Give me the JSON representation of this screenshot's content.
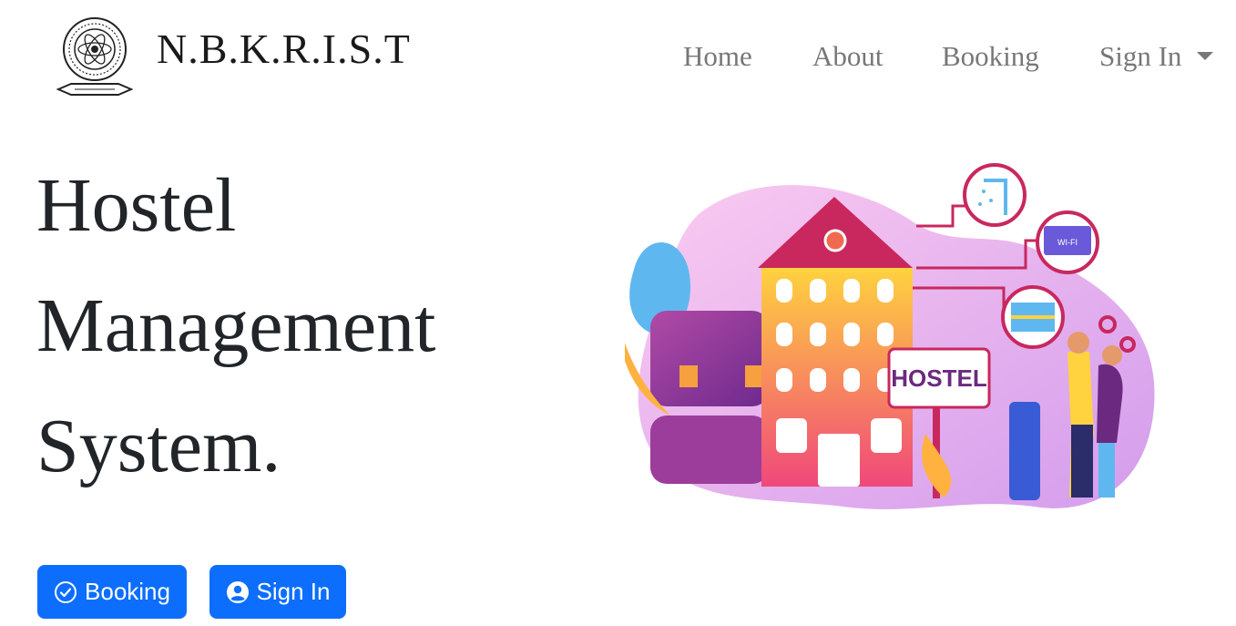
{
  "brand": {
    "name": "N.B.K.R.I.S.T",
    "logo_icon": "college-seal-icon"
  },
  "nav": {
    "home": "Home",
    "about": "About",
    "booking": "Booking",
    "signin": "Sign In",
    "signin_caret_icon": "caret-down-icon"
  },
  "hero": {
    "title_lines": [
      "Hostel",
      "Management",
      "System."
    ],
    "illustration_sign": "HOSTEL",
    "illustration_wifi": "WI-FI"
  },
  "buttons": {
    "booking": {
      "label": "Booking",
      "icon": "check-circle-icon"
    },
    "signin": {
      "label": "Sign In",
      "icon": "user-circle-icon"
    }
  },
  "colors": {
    "primary": "#0d6efd",
    "nav_text": "#777777",
    "heading": "#212529"
  }
}
